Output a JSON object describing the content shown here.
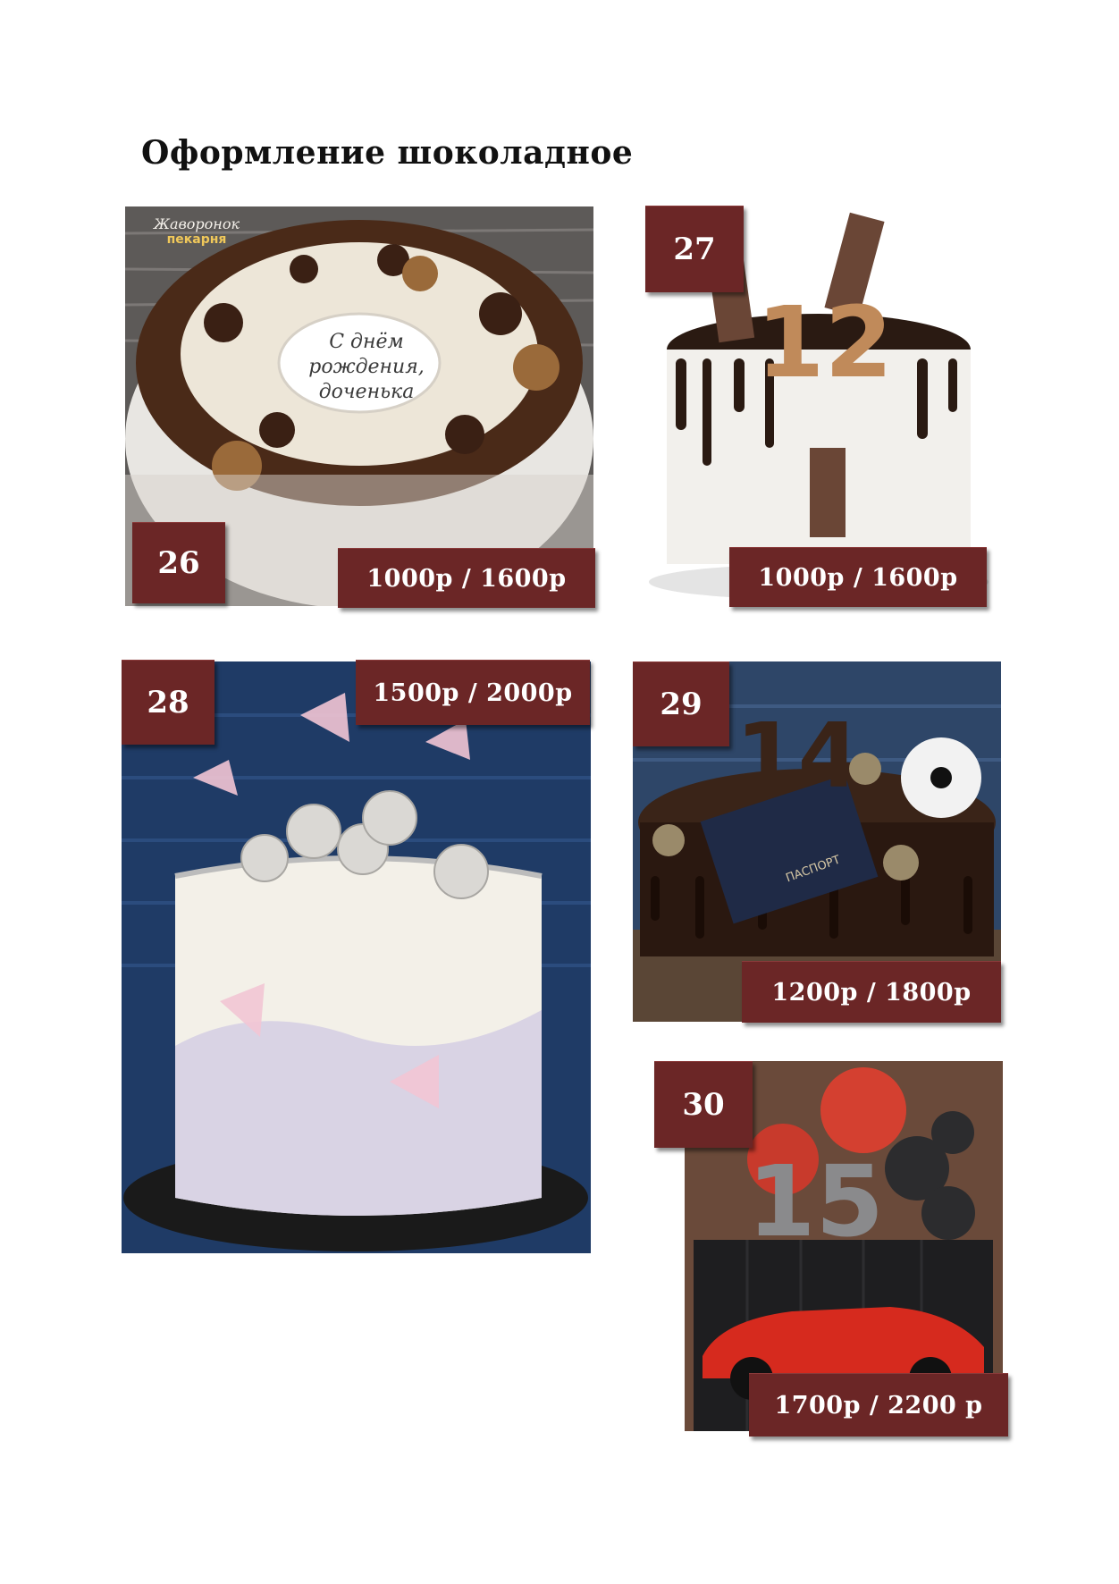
{
  "page": {
    "title": "Оформление шоколадное"
  },
  "colors": {
    "badge_bg": "#6b2626",
    "badge_text": "#ffffff"
  },
  "cakes": [
    {
      "number": "26",
      "price": "1000р / 1600р",
      "watermark_script": "Жаворонок",
      "watermark_brand": "пекарня",
      "inscription": "С днём рождения, доченька"
    },
    {
      "number": "27",
      "price": "1000р / 1600р"
    },
    {
      "number": "28",
      "price": "1500р / 2000р"
    },
    {
      "number": "29",
      "price": "1200р / 1800р",
      "passport_text": "ПАСПОРТ"
    },
    {
      "number": "30",
      "price": "1700р / 2200 р"
    }
  ]
}
